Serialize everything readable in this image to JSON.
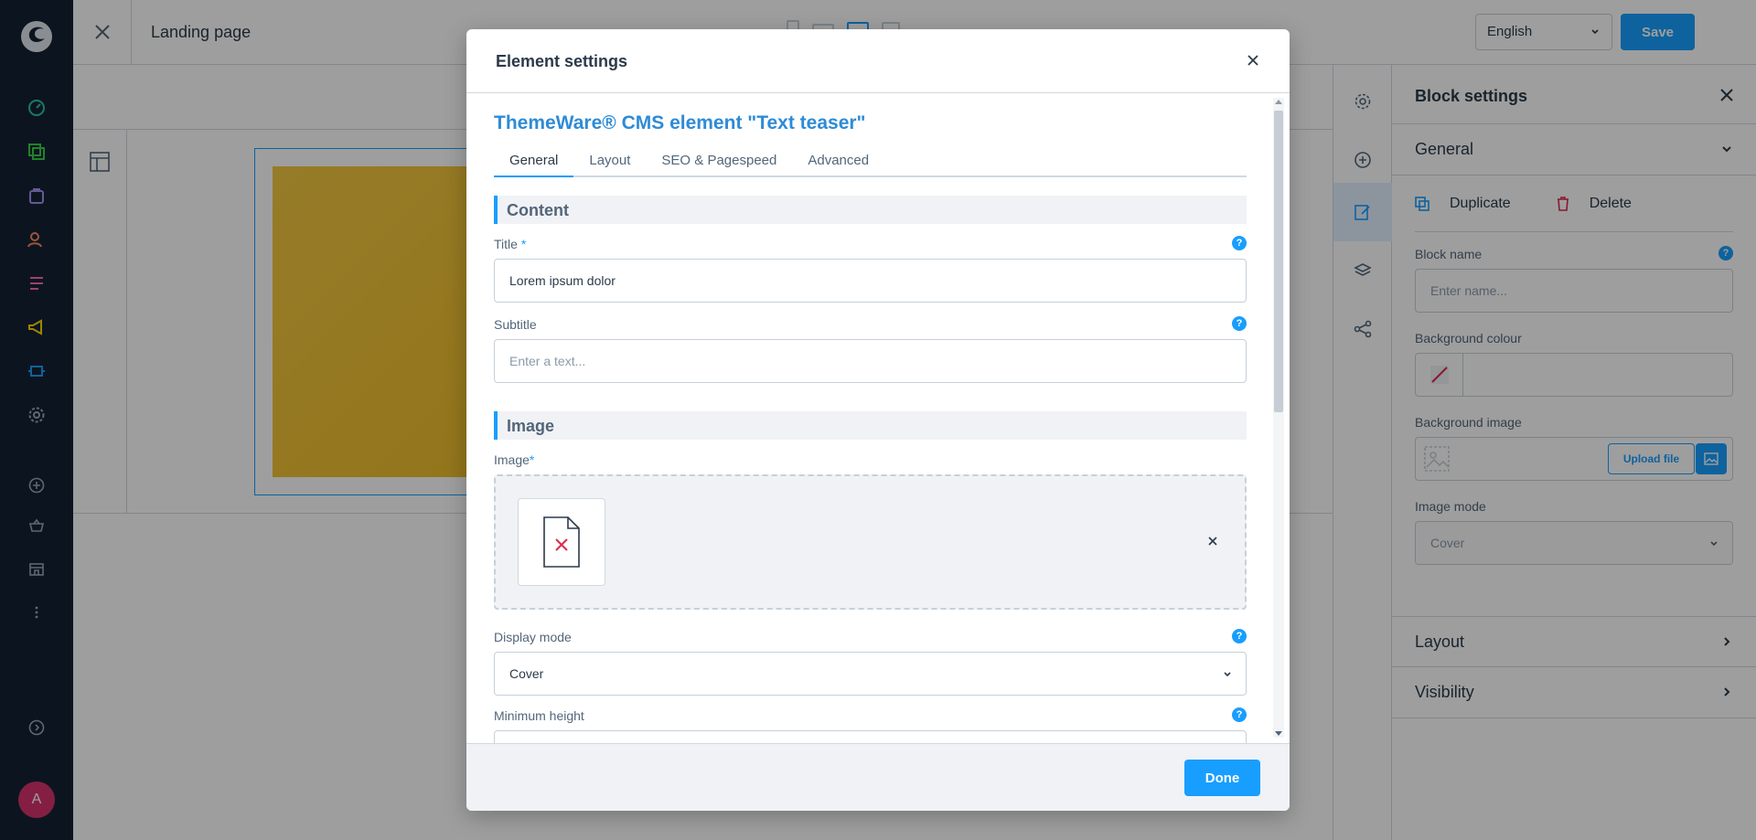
{
  "app": {
    "page_title": "Landing page"
  },
  "topbar": {
    "language": "English",
    "save_label": "Save"
  },
  "adminnav": {
    "icons": [
      "dashboard-icon",
      "catalogue-icon",
      "orders-icon",
      "customers-icon",
      "content-icon",
      "marketing-icon",
      "extensions-icon",
      "settings-icon",
      "add-icon",
      "sales-channel-basket-icon",
      "sales-channel-store-icon",
      "more-icon",
      "help-icon"
    ],
    "avatar_letter": "A",
    "colors": {
      "bg": "#142233",
      "avatar": "#d6336c"
    }
  },
  "block_settings": {
    "title": "Block settings",
    "general_label": "General",
    "duplicate_label": "Duplicate",
    "delete_label": "Delete",
    "block_name_label": "Block name",
    "block_name_placeholder": "Enter name...",
    "bg_colour_label": "Background colour",
    "bg_image_label": "Background image",
    "upload_label": "Upload file",
    "image_mode_label": "Image mode",
    "image_mode_value": "Cover",
    "layout_label": "Layout",
    "visibility_label": "Visibility"
  },
  "modal": {
    "title": "Element settings",
    "element_heading": "ThemeWare® CMS element \"Text teaser\"",
    "tabs": [
      "General",
      "Layout",
      "SEO & Pagespeed",
      "Advanced"
    ],
    "content_section": "Content",
    "title_label": "Title",
    "title_value": "Lorem ipsum dolor",
    "subtitle_label": "Subtitle",
    "subtitle_placeholder": "Enter a text...",
    "image_section": "Image",
    "image_label": "Image",
    "display_mode_label": "Display mode",
    "display_mode_value": "Cover",
    "min_height_label": "Minimum height",
    "done_label": "Done",
    "required_mark": "*",
    "help_glyph": "?"
  },
  "colors": {
    "accent": "#189eff",
    "heading_blue": "#2e8bd6",
    "image_yellow": "#f4c842",
    "danger": "#de294c"
  }
}
